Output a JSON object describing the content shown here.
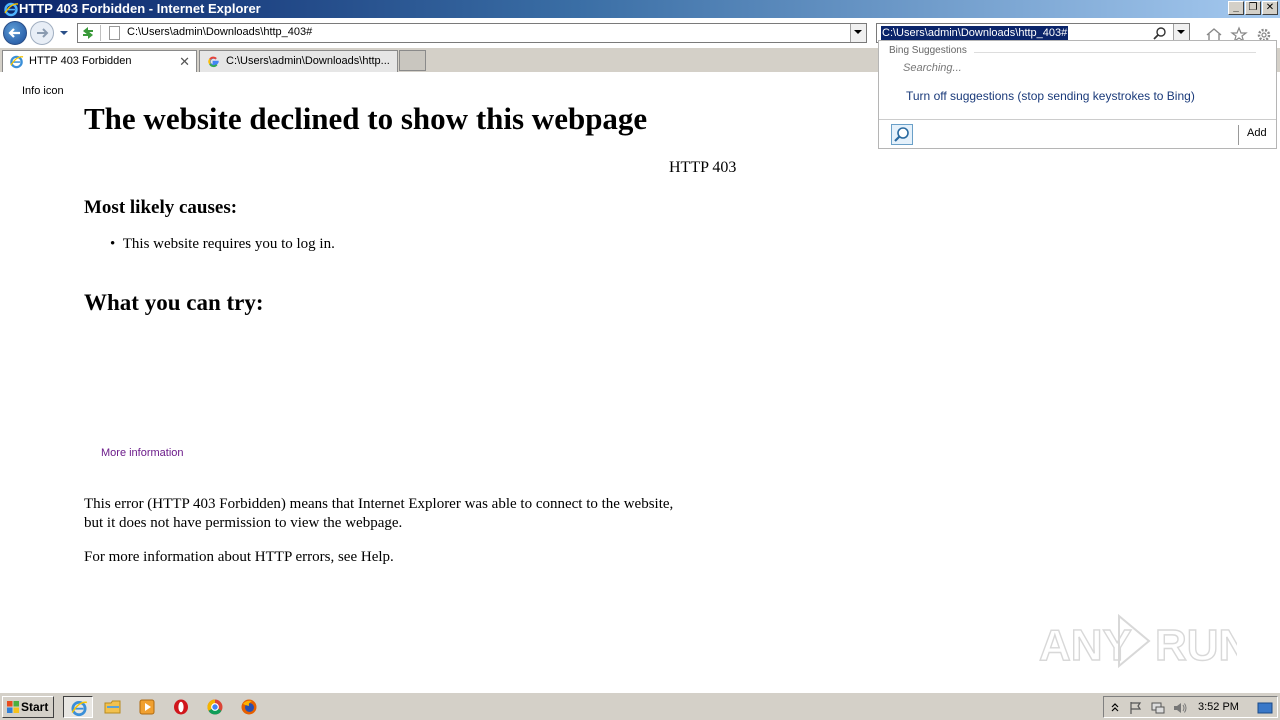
{
  "window": {
    "title": "HTTP 403 Forbidden - Internet Explorer",
    "controls": {
      "minimize": "_",
      "restore": "❐",
      "close": "✕"
    }
  },
  "address_bar": {
    "url": "C:\\Users\\admin\\Downloads\\http_403#"
  },
  "search_box": {
    "value": "C:\\Users\\admin\\Downloads\\http_403#"
  },
  "tabs": [
    {
      "label": "HTTP 403 Forbidden",
      "icon": "ie-icon",
      "active": true
    },
    {
      "label": "C:\\Users\\admin\\Downloads\\http...",
      "icon": "google-icon",
      "active": false
    }
  ],
  "page": {
    "info_icon_alt": "Info icon",
    "heading": "The website declined to show this webpage",
    "error_code": "HTTP 403",
    "causes_heading": "Most likely causes:",
    "causes": [
      "This website requires you to log in."
    ],
    "try_heading": "What you can try:",
    "more_info": "More information",
    "explanation_line1": "This error (HTTP 403 Forbidden) means that Internet Explorer was able to connect to the website,",
    "explanation_line2": "but it does not have permission to view the webpage.",
    "help_text": "For more information about HTTP errors, see Help."
  },
  "bing_dropdown": {
    "header": "Bing Suggestions",
    "searching": "Searching...",
    "turn_off": "Turn off suggestions (stop sending keystrokes to Bing)",
    "add": "Add"
  },
  "taskbar": {
    "start_label": "Start",
    "clock": "3:52 PM",
    "pinned": [
      "ie-icon",
      "folder-icon",
      "media-player-icon",
      "opera-icon",
      "chrome-icon",
      "firefox-icon"
    ]
  },
  "watermark": "ANY RUN",
  "colors": {
    "title_bar_start": "#0a246a",
    "link_visited": "#6b1b8a",
    "selection": "#0a246a",
    "taskbar": "#d4d0c8"
  }
}
